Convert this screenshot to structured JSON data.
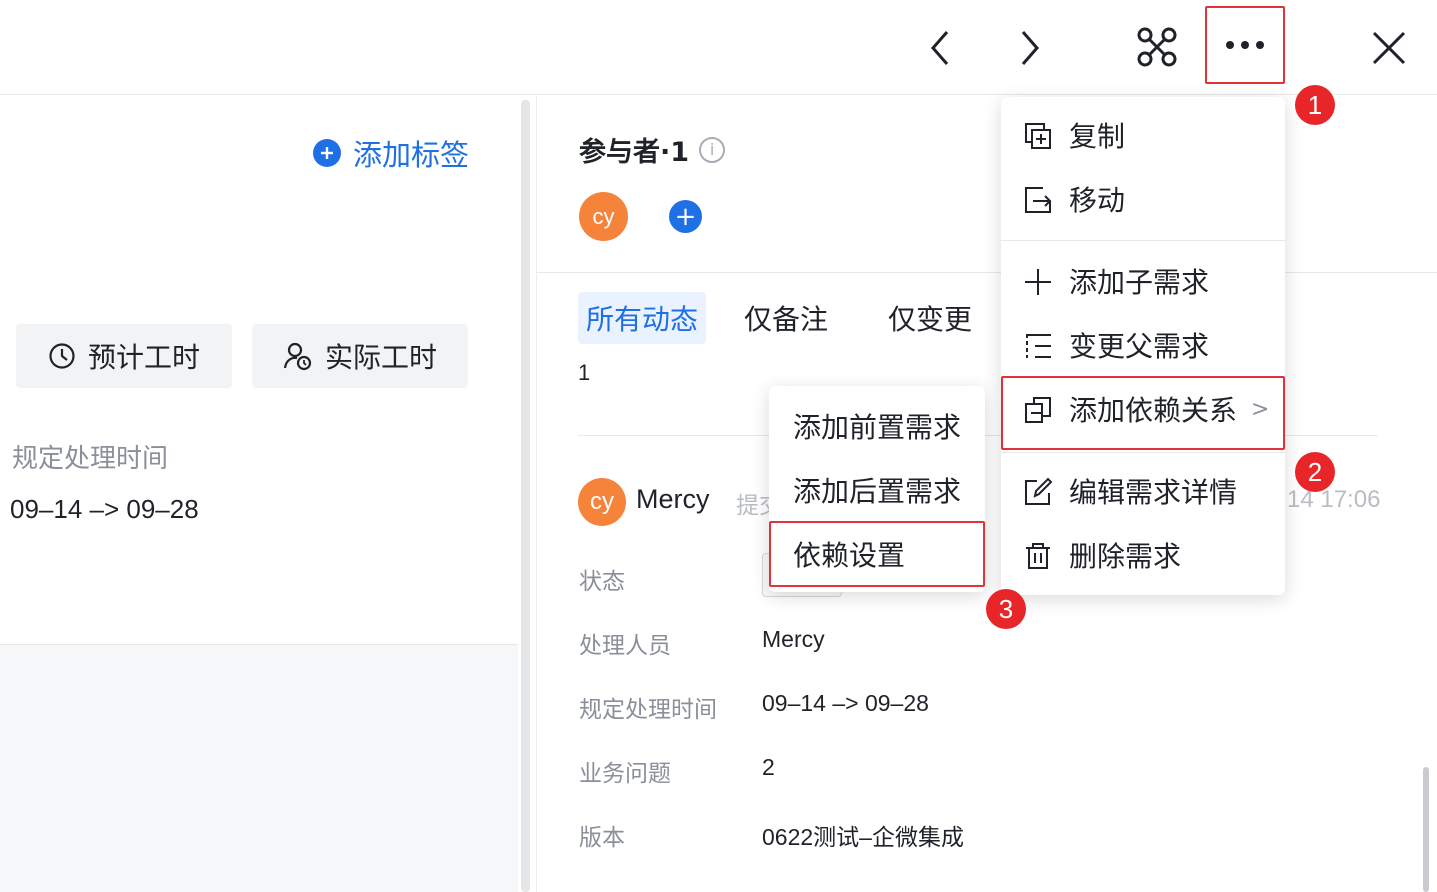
{
  "topbar": {
    "prev_icon": "chevron-left-icon",
    "next_icon": "chevron-right-icon",
    "graph_icon": "dependency-graph-icon",
    "more_icon": "more-dots-icon",
    "close_icon": "close-icon"
  },
  "left": {
    "add_tag": "添加标签",
    "estimated_hours": "预计工时",
    "actual_hours": "实际工时",
    "due_label": "规定处理时间",
    "due_value": "09–14 –> 09–28"
  },
  "participants": {
    "title": "参与者·1",
    "info": "i",
    "avatar_text": "cy",
    "add": "+"
  },
  "tabs": [
    {
      "label": "所有动态",
      "active": true
    },
    {
      "label": "仅备注",
      "active": false
    },
    {
      "label": "仅变更",
      "active": false
    }
  ],
  "count": "1",
  "activity": {
    "avatar_text": "cy",
    "user": "Mercy",
    "action": "提交",
    "time": "14 17:06"
  },
  "fields": [
    {
      "label": "状态",
      "value": ""
    },
    {
      "label": "处理人员",
      "value": "Mercy"
    },
    {
      "label": "规定处理时间",
      "value": "09–14 –> 09–28"
    },
    {
      "label": "业务问题",
      "value": "2"
    },
    {
      "label": "版本",
      "value": "0622测试–企微集成"
    }
  ],
  "more_menu": {
    "items": [
      {
        "label": "复制",
        "icon": "copy-icon"
      },
      {
        "label": "移动",
        "icon": "move-icon"
      },
      {
        "label": "添加子需求",
        "icon": "plus-icon"
      },
      {
        "label": "变更父需求",
        "icon": "tree-icon"
      },
      {
        "label": "添加依赖关系",
        "icon": "dependency-icon",
        "arrow": ">"
      },
      {
        "label": "编辑需求详情",
        "icon": "edit-icon"
      },
      {
        "label": "删除需求",
        "icon": "trash-icon"
      }
    ]
  },
  "dependency_submenu": {
    "items": [
      {
        "label": "添加前置需求"
      },
      {
        "label": "添加后置需求"
      },
      {
        "label": "依赖设置"
      }
    ]
  },
  "annotations": [
    "1",
    "2",
    "3"
  ],
  "colors": {
    "accent": "#1f6fe5",
    "highlight": "#e0343a",
    "avatar": "#f5833a"
  }
}
